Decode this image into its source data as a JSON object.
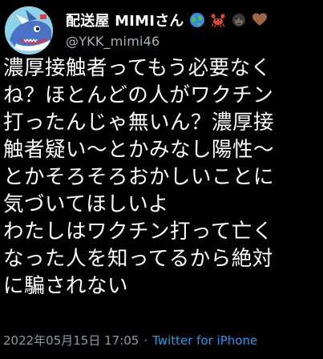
{
  "tweet": {
    "display_name": "配送屋 MIMIさん",
    "name_emojis": [
      "globe-emoji",
      "crab-emoji",
      "gorilla-emoji",
      "heart-emoji"
    ],
    "handle": "@YKK_mimi46",
    "body_lines": [
      "濃厚接触者ってもう必要なく",
      "ね？ほとんどの人がワクチン",
      "打ったんじゃ無いん？濃厚接",
      "触者疑い〜とかみなし陽性〜",
      "とかそろそろおかしいことに",
      "気づいてほしいよ",
      "わたしはワクチン打って亡く",
      "なった人を知ってるから絶対",
      "に騙されない"
    ],
    "timestamp": "2022年05月15日 17:05",
    "separator": "·",
    "source": "Twitter for iPhone"
  },
  "colors": {
    "background": "#000000",
    "text": "#ffffff",
    "secondary_text": "#8b98a5",
    "link": "#1d9bf0"
  }
}
